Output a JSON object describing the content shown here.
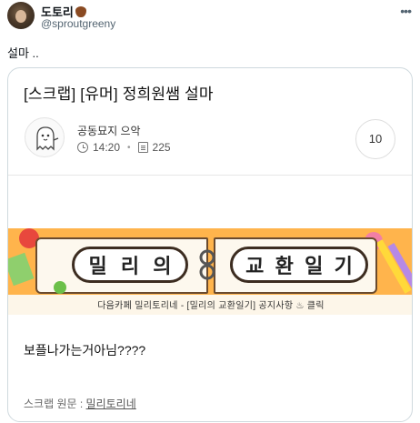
{
  "tweet": {
    "user_name": "도토리",
    "user_handle": "@sproutgreeny",
    "text": "설마 .."
  },
  "card": {
    "title": "[스크랩] [유머] 정희원쌤 설마",
    "cafe_name": "공동묘지 으악",
    "time": "14:20",
    "views": "225",
    "comments": "10",
    "banner": {
      "badge_left": [
        "밀",
        "리",
        "의"
      ],
      "badge_right": [
        "교",
        "환",
        "일",
        "기"
      ],
      "caption": "다음카페 밀리토리네 - [밀리의 교환일기] 공지사항 ♨ 클릭"
    },
    "post_text": "보플나가는거아님????",
    "source_label": "스크랩 원문 : ",
    "source_link": "밀리토리네"
  },
  "colors": {
    "banner_orange": "#ffb44c",
    "border": "#cfd9de",
    "secondary_text": "#536471"
  },
  "icons": [
    "chestnut-icon",
    "more-icon",
    "clock-icon",
    "view-icon",
    "ghost-avatar-icon"
  ]
}
